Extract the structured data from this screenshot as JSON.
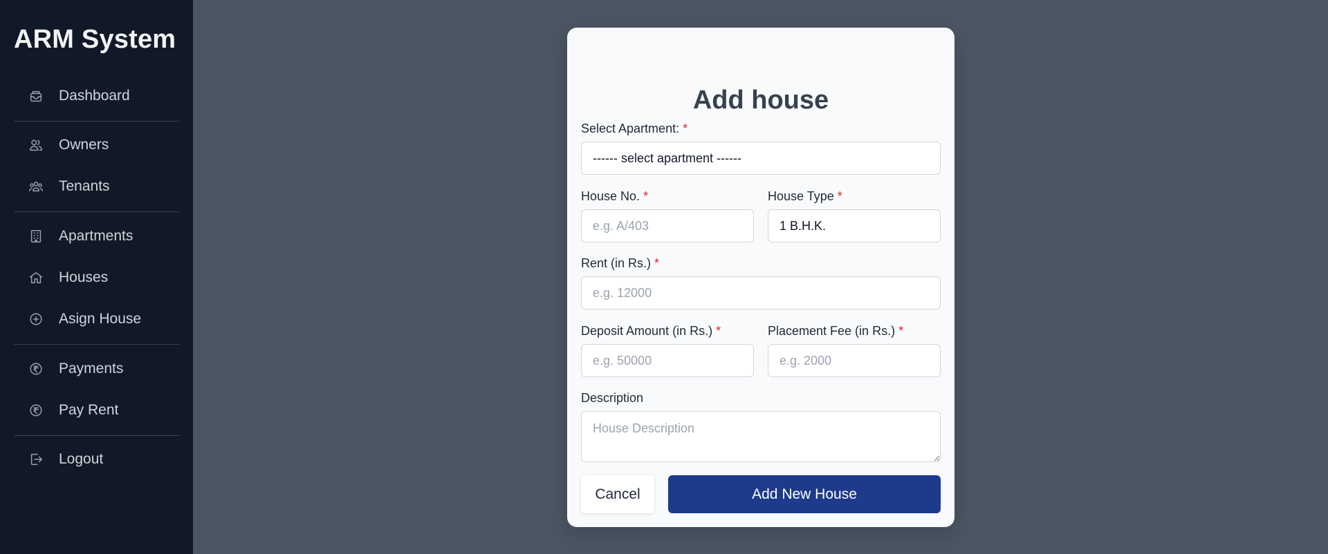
{
  "sidebar": {
    "brand": "ARM System",
    "items": [
      {
        "label": "Dashboard",
        "icon": "inbox-icon"
      },
      {
        "label": "Owners",
        "icon": "users-icon"
      },
      {
        "label": "Tenants",
        "icon": "user-group-icon"
      },
      {
        "label": "Apartments",
        "icon": "building-icon"
      },
      {
        "label": "Houses",
        "icon": "home-icon"
      },
      {
        "label": "Asign House",
        "icon": "plus-circle-icon"
      },
      {
        "label": "Payments",
        "icon": "rupee-circle-icon"
      },
      {
        "label": "Pay Rent",
        "icon": "rupee-circle-icon"
      },
      {
        "label": "Logout",
        "icon": "logout-icon"
      }
    ]
  },
  "form": {
    "title": "Add house",
    "required_mark": "*",
    "apartment": {
      "label": "Select Apartment:",
      "value": "------ select apartment ------"
    },
    "house_no": {
      "label": "House No.",
      "placeholder": "e.g. A/403"
    },
    "house_type": {
      "label": "House Type",
      "value": "1 B.H.K."
    },
    "rent": {
      "label": "Rent (in Rs.)",
      "placeholder": "e.g. 12000"
    },
    "deposit": {
      "label": "Deposit Amount (in Rs.)",
      "placeholder": "e.g. 50000"
    },
    "placement_fee": {
      "label": "Placement Fee (in Rs.)",
      "placeholder": "e.g. 2000"
    },
    "description": {
      "label": "Description",
      "placeholder": "House Description"
    },
    "cancel_label": "Cancel",
    "submit_label": "Add New House"
  },
  "colors": {
    "sidebar_bg": "#111827",
    "backdrop": "#4b5563",
    "primary": "#1e3a8a",
    "required": "#dc2626"
  }
}
